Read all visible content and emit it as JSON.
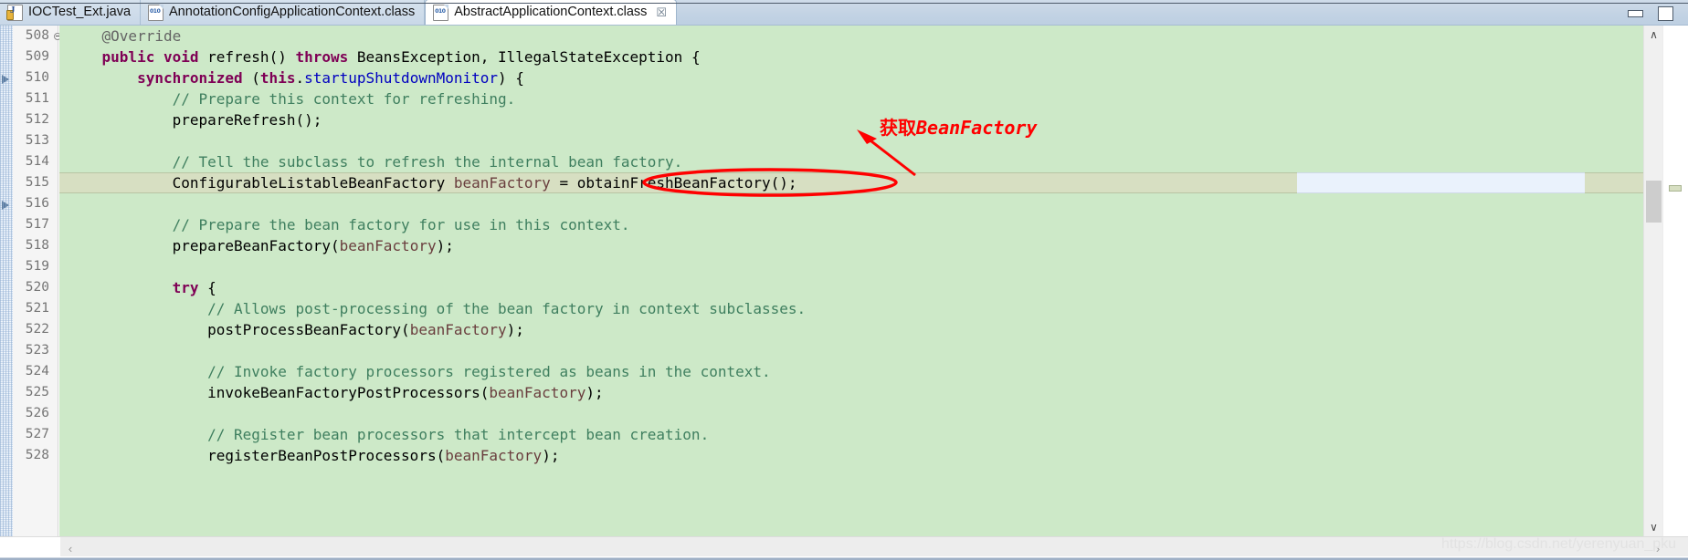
{
  "window": {
    "controls": [
      {
        "name": "minimize",
        "label": "–"
      },
      {
        "name": "maximize",
        "label": "□"
      }
    ]
  },
  "tabs": [
    {
      "label": "IOCTest_Ext.java",
      "icon": "java-file-icon",
      "active": false,
      "closable": false
    },
    {
      "label": "AnnotationConfigApplicationContext.class",
      "icon": "class-file-icon",
      "active": false,
      "closable": false
    },
    {
      "label": "AbstractApplicationContext.class",
      "icon": "class-file-icon",
      "active": true,
      "closable": true,
      "close_glyph": "☒"
    }
  ],
  "editor": {
    "first_line": 508,
    "current_line": 515,
    "background": "#cde9c8",
    "current_line_background": "#d7dfc2",
    "colors": {
      "keyword": "#7f0055",
      "comment": "#3f7f5f",
      "field": "#0000c0",
      "local_variable": "#6a3e3e",
      "annotation": "#646464",
      "plain": "#000000"
    },
    "lines": [
      {
        "num": "508",
        "indent": 1,
        "fold": true,
        "tokens": [
          {
            "t": "@Override",
            "c": "ann"
          }
        ]
      },
      {
        "num": "509",
        "indent": 1,
        "tokens": [
          {
            "t": "public",
            "c": "kw"
          },
          {
            "t": " ",
            "c": "plain"
          },
          {
            "t": "void",
            "c": "kw"
          },
          {
            "t": " refresh() ",
            "c": "plain"
          },
          {
            "t": "throws",
            "c": "kw"
          },
          {
            "t": " BeansException, IllegalStateException {",
            "c": "plain"
          }
        ]
      },
      {
        "num": "510",
        "indent": 2,
        "tokens": [
          {
            "t": "synchronized",
            "c": "kw"
          },
          {
            "t": " (",
            "c": "plain"
          },
          {
            "t": "this",
            "c": "kw"
          },
          {
            "t": ".",
            "c": "plain"
          },
          {
            "t": "startupShutdownMonitor",
            "c": "fld"
          },
          {
            "t": ") {",
            "c": "plain"
          }
        ]
      },
      {
        "num": "511",
        "indent": 3,
        "tokens": [
          {
            "t": "// Prepare this context for refreshing.",
            "c": "cmt"
          }
        ]
      },
      {
        "num": "512",
        "indent": 3,
        "tokens": [
          {
            "t": "prepareRefresh();",
            "c": "plain"
          }
        ]
      },
      {
        "num": "513",
        "indent": 0,
        "tokens": []
      },
      {
        "num": "514",
        "indent": 3,
        "tokens": [
          {
            "t": "// Tell the subclass to refresh the internal bean factory.",
            "c": "cmt"
          }
        ]
      },
      {
        "num": "515",
        "indent": 3,
        "current": true,
        "tokens": [
          {
            "t": "ConfigurableListableBeanFactory ",
            "c": "plain"
          },
          {
            "t": "beanFactory",
            "c": "loc"
          },
          {
            "t": " = obtainFreshBeanFactory();",
            "c": "plain"
          }
        ]
      },
      {
        "num": "516",
        "indent": 0,
        "tokens": []
      },
      {
        "num": "517",
        "indent": 3,
        "tokens": [
          {
            "t": "// Prepare the bean factory for use in this context.",
            "c": "cmt"
          }
        ]
      },
      {
        "num": "518",
        "indent": 3,
        "tokens": [
          {
            "t": "prepareBeanFactory(",
            "c": "plain"
          },
          {
            "t": "beanFactory",
            "c": "loc"
          },
          {
            "t": ");",
            "c": "plain"
          }
        ]
      },
      {
        "num": "519",
        "indent": 0,
        "tokens": []
      },
      {
        "num": "520",
        "indent": 3,
        "tokens": [
          {
            "t": "try",
            "c": "kw"
          },
          {
            "t": " {",
            "c": "plain"
          }
        ]
      },
      {
        "num": "521",
        "indent": 4,
        "tokens": [
          {
            "t": "// Allows post-processing of the bean factory in context subclasses.",
            "c": "cmt"
          }
        ]
      },
      {
        "num": "522",
        "indent": 4,
        "tokens": [
          {
            "t": "postProcessBeanFactory(",
            "c": "plain"
          },
          {
            "t": "beanFactory",
            "c": "loc"
          },
          {
            "t": ");",
            "c": "plain"
          }
        ]
      },
      {
        "num": "523",
        "indent": 0,
        "tokens": []
      },
      {
        "num": "524",
        "indent": 4,
        "tokens": [
          {
            "t": "// Invoke factory processors registered as beans in the context.",
            "c": "cmt"
          }
        ]
      },
      {
        "num": "525",
        "indent": 4,
        "tokens": [
          {
            "t": "invokeBeanFactoryPostProcessors(",
            "c": "plain"
          },
          {
            "t": "beanFactory",
            "c": "loc"
          },
          {
            "t": ");",
            "c": "plain"
          }
        ]
      },
      {
        "num": "526",
        "indent": 0,
        "tokens": []
      },
      {
        "num": "527",
        "indent": 4,
        "tokens": [
          {
            "t": "// Register bean processors that intercept bean creation.",
            "c": "cmt"
          }
        ]
      },
      {
        "num": "528",
        "indent": 4,
        "tokens": [
          {
            "t": "registerBeanPostProcessors(",
            "c": "plain"
          },
          {
            "t": "beanFactory",
            "c": "loc"
          },
          {
            "t": ");",
            "c": "plain"
          }
        ]
      }
    ]
  },
  "scrollbars": {
    "vertical": {
      "up_glyph": "∧",
      "down_glyph": "∨"
    },
    "horizontal": {
      "left_glyph": "‹",
      "right_glyph": "›"
    }
  },
  "annotation": {
    "color": "#ff0000",
    "cjk_text": "获取",
    "latin_text": "BeanFactory",
    "highlight_target": "obtainFreshBeanFactory();"
  },
  "watermark": {
    "text": "https://blog.csdn.net/yerenyuan_pku"
  }
}
